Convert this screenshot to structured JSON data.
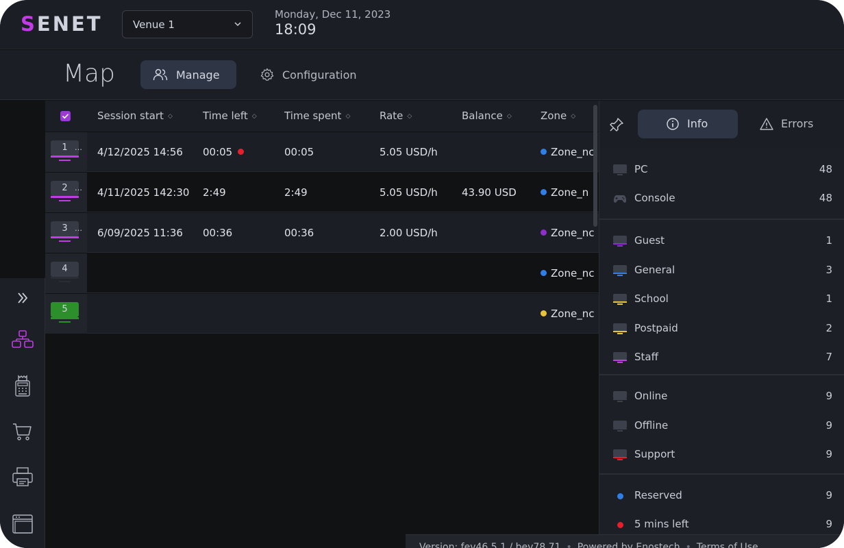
{
  "app": {
    "logo_first": "S",
    "logo_rest": "ENET",
    "venue": "Venue 1",
    "date": "Monday, Dec 11, 2023",
    "time": "18:09"
  },
  "header": {
    "title": "Map",
    "manage_label": "Manage",
    "config_label": "Configuration"
  },
  "table": {
    "columns": [
      "Session start",
      "Time left",
      "Time spent",
      "Rate",
      "Balance",
      "Zone"
    ],
    "rows": [
      {
        "num": "1",
        "session_start": "4/12/2025 14:56",
        "time_left": "00:05",
        "time_spent": "00:05",
        "rate": "5.05 USD/h",
        "balance": "",
        "zone": "Zone_nc",
        "zone_color": "#2f7fe6",
        "bar_color": "#c23be6",
        "pc_color": "#353a45",
        "low_time": true
      },
      {
        "num": "2",
        "session_start": "4/11/2025 142:30",
        "time_left": "2:49",
        "time_spent": "2:49",
        "rate": "5.05 USD/h",
        "balance": "43.90 USD",
        "zone": "Zone_n",
        "zone_color": "#2f7fe6",
        "bar_color": "#c23be6",
        "pc_color": "#353a45",
        "low_time": false
      },
      {
        "num": "3",
        "session_start": "6/09/2025 11:36",
        "time_left": "00:36",
        "time_spent": "00:36",
        "rate": "2.00 USD/h",
        "balance": "",
        "zone": "Zone_nc",
        "zone_color": "#8e2fc9",
        "bar_color": "#c23be6",
        "pc_color": "#353a45",
        "low_time": false
      },
      {
        "num": "4",
        "session_start": "",
        "time_left": "",
        "time_spent": "",
        "rate": "",
        "balance": "",
        "zone": "Zone_nc",
        "zone_color": "#2f7fe6",
        "bar_color": "#2a2d34",
        "pc_color": "#353a45",
        "low_time": false
      },
      {
        "num": "5",
        "session_start": "",
        "time_left": "",
        "time_spent": "",
        "rate": "",
        "balance": "",
        "zone": "Zone_nc",
        "zone_color": "#e8c33a",
        "bar_color": "#2c8f2c",
        "pc_color": "#2c8f2c",
        "low_time": false
      }
    ]
  },
  "panel": {
    "info_label": "Info",
    "errors_label": "Errors",
    "groups": [
      [
        {
          "label": "PC",
          "count": "48",
          "icon": "monitor-icon",
          "bar": "#3b404b"
        },
        {
          "label": "Console",
          "count": "48",
          "icon": "gamepad-icon",
          "bar": ""
        }
      ],
      [
        {
          "label": "Guest",
          "count": "1",
          "icon": "monitor-icon",
          "bar": "#8e2fc9"
        },
        {
          "label": "General",
          "count": "3",
          "icon": "monitor-icon",
          "bar": "#2f7fe6"
        },
        {
          "label": "School",
          "count": "1",
          "icon": "monitor-icon",
          "bar": "#e8c33a"
        },
        {
          "label": "Postpaid",
          "count": "2",
          "icon": "monitor-icon",
          "bar": "#e8c33a"
        },
        {
          "label": "Staff",
          "count": "7",
          "icon": "monitor-icon",
          "bar": "#c23be6"
        }
      ],
      [
        {
          "label": "Online",
          "count": "9",
          "icon": "monitor-icon",
          "bar": "#3b404b"
        },
        {
          "label": "Offline",
          "count": "9",
          "icon": "monitor-icon",
          "bar": "#3b404b"
        },
        {
          "label": "Support",
          "count": "9",
          "icon": "monitor-icon",
          "bar": "#e3202b"
        }
      ],
      [
        {
          "label": "Reserved",
          "count": "9",
          "icon": "dot",
          "dot": "#2f7fe6"
        },
        {
          "label": "5 mins left",
          "count": "9",
          "icon": "dot",
          "dot": "#e3202b"
        }
      ]
    ]
  },
  "footer": {
    "version": "Version: fev46.5.1 / bev78.71",
    "powered": "Powered by Enostech",
    "terms": "Terms of Use"
  },
  "colors": {
    "accent": "#c23be6",
    "active_bg": "#2e3545"
  }
}
